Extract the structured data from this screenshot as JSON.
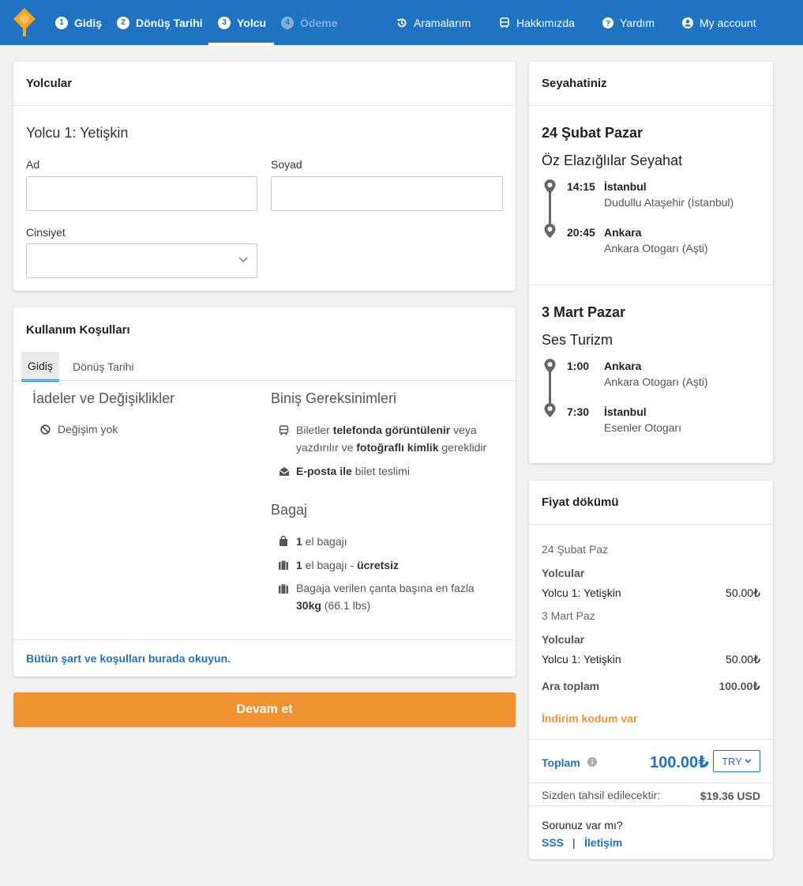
{
  "nav": {
    "steps": [
      {
        "num": "1",
        "label": "Gidiş"
      },
      {
        "num": "2",
        "label": "Dönüş Tarihi"
      },
      {
        "num": "3",
        "label": "Yolcu"
      },
      {
        "num": "4",
        "label": "Ödeme"
      }
    ],
    "links": {
      "searches": "Aramalarım",
      "about": "Hakkımızda",
      "help": "Yardım",
      "account": "My account"
    }
  },
  "passengers": {
    "header": "Yolcular",
    "passenger_title": "Yolcu 1: Yetişkin",
    "first_name_label": "Ad",
    "first_name_value": "",
    "last_name_label": "Soyad",
    "last_name_value": "",
    "gender_label": "Cinsiyet",
    "gender_value": ""
  },
  "terms": {
    "header": "Kullanım Koşulları",
    "tabs": [
      "Gidiş",
      "Dönüş Tarihi"
    ],
    "refunds_title": "İadeler ve Değişiklikler",
    "no_change": "Değişim yok",
    "boarding_title": "Biniş Gereksinimleri",
    "boarding_1": {
      "a": "Biletler ",
      "b": "telefonda görüntülenir",
      "c": " veya yazdırılır ve ",
      "d": "fotoğraflı kimlik",
      "e": " gereklidir"
    },
    "boarding_2": {
      "a": "E-posta ile",
      "b": " bilet teslimi"
    },
    "baggage_title": "Bagaj",
    "bag_1": {
      "a": "1",
      "b": " el bagajı"
    },
    "bag_2": {
      "a": "1",
      "b": " el bagajı - ",
      "c": "ücretsiz"
    },
    "bag_3": {
      "a": "Bagaja verilen çanta başına en fazla ",
      "b": "30kg",
      "c": " (66.1 lbs)"
    },
    "read_all": "Bütün şart ve koşulları burada okuyun."
  },
  "continue_label": "Devam et",
  "trip": {
    "header": "Seyahatiniz",
    "legs": [
      {
        "date": "24 Şubat Pazar",
        "operator": "Öz Elazığlılar Seyahat",
        "dep_time": "14:15",
        "dep_city": "İstanbul",
        "dep_station": "Dudullu Ataşehir (İstanbul)",
        "arr_time": "20:45",
        "arr_city": "Ankara",
        "arr_station": "Ankara Otogarı (Aşti)"
      },
      {
        "date": "3 Mart Pazar",
        "operator": "Ses Turizm",
        "dep_time": "1:00",
        "dep_city": "Ankara",
        "dep_station": "Ankara Otogarı (Aşti)",
        "arr_time": "7:30",
        "arr_city": "İstanbul",
        "arr_station": "Esenler Otogarı"
      }
    ]
  },
  "price": {
    "header": "Fiyat dökümü",
    "leg1_date": "24 Şubat Paz",
    "leg2_date": "3 Mart Paz",
    "passengers_label": "Yolcular",
    "passenger_line": "Yolcu 1: Yetişkin",
    "leg1_amount": "50.00₺",
    "leg2_amount": "50.00₺",
    "subtotal_label": "Ara toplam",
    "subtotal": "100.00₺",
    "discount": "İndirim kodum var",
    "total_label": "Toplam",
    "total": "100.00₺",
    "currency": "TRY",
    "charged_label": "Sizden tahsil edilecektir:",
    "charged": "$19.36 USD",
    "question": "Sorunuz var mı?",
    "faq": "SSS",
    "separator": "|",
    "contact": "İletişim"
  },
  "colors": {
    "brand": "#1f73c0",
    "accent": "#ef9332",
    "logo": "#f5a623"
  }
}
